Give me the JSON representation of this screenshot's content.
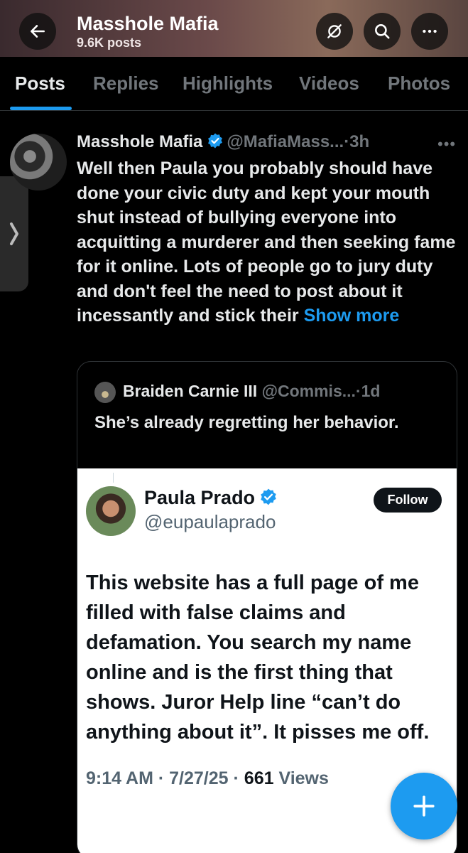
{
  "header": {
    "title": "Masshole Mafia",
    "post_count": "9.6K posts",
    "icons": [
      "back-arrow-icon",
      "hide-icon",
      "search-icon",
      "more-icon"
    ]
  },
  "tabs": [
    {
      "label": "Posts",
      "active": true
    },
    {
      "label": "Replies",
      "active": false
    },
    {
      "label": "Highlights",
      "active": false
    },
    {
      "label": "Videos",
      "active": false
    },
    {
      "label": "Photos",
      "active": false
    }
  ],
  "post": {
    "author_name": "Masshole Mafia",
    "handle": "@MafiaMass...",
    "time": "·3h",
    "text": "Well then Paula you probably should have done your civic duty and kept your mouth shut instead of bullying everyone into acquitting a murderer and then seeking fame for it online. Lots of people go to jury duty and don't feel the need to post about it incessantly and stick their",
    "show_more": "Show more"
  },
  "quote": {
    "author_name": "Braiden Carnie III",
    "handle": "@Commis...",
    "time": "·1d",
    "text": "She’s already regretting her behavior.",
    "embedded": {
      "name": "Paula Prado",
      "handle": "@eupaulaprado",
      "follow_label": "Follow",
      "text": "This website has a full page of me filled with false claims and defamation. You search my name online and is the first thing that shows. Juror Help line “can’t do anything about it”. It pisses me off.",
      "timestamp": "9:14 AM · 7/27/25 ·",
      "views_count": "661",
      "views_label": "Views"
    }
  },
  "colors": {
    "accent": "#1d9bf0",
    "background": "#000000",
    "muted": "#71767b"
  }
}
